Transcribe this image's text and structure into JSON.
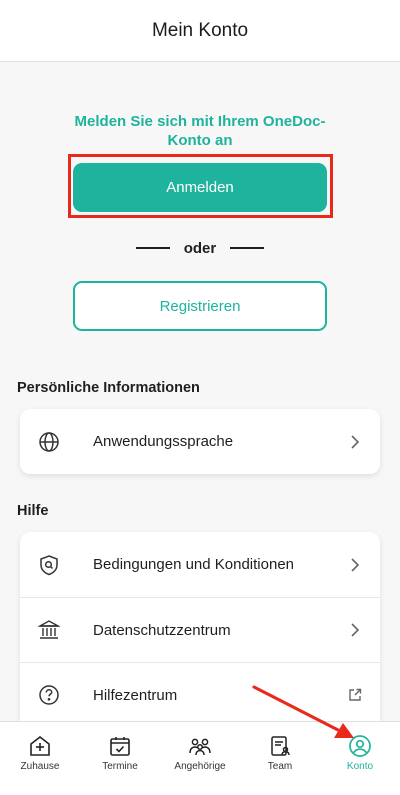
{
  "header": {
    "title": "Mein Konto"
  },
  "login": {
    "title": "Melden Sie sich mit Ihrem OneDoc-Konto an",
    "login_label": "Anmelden",
    "or_label": "oder",
    "register_label": "Registrieren"
  },
  "personal": {
    "heading": "Persönliche Informationen",
    "items": [
      {
        "label": "Anwendungssprache",
        "icon": "globe-icon"
      }
    ]
  },
  "help": {
    "heading": "Hilfe",
    "items": [
      {
        "label": "Bedingungen und Konditionen",
        "icon": "shield-search-icon"
      },
      {
        "label": "Datenschutzzentrum",
        "icon": "bank-icon"
      },
      {
        "label": "Hilfezentrum",
        "icon": "question-circle-icon"
      }
    ]
  },
  "tabbar": {
    "tabs": [
      {
        "label": "Zuhause",
        "icon": "home-plus-icon"
      },
      {
        "label": "Termine",
        "icon": "calendar-check-icon"
      },
      {
        "label": "Angehörige",
        "icon": "family-icon"
      },
      {
        "label": "Team",
        "icon": "clipboard-team-icon"
      },
      {
        "label": "Konto",
        "icon": "account-icon",
        "active": true
      }
    ]
  },
  "colors": {
    "accent": "#1eb39c",
    "highlight": "#e8291c",
    "background": "#f7f7f7"
  }
}
